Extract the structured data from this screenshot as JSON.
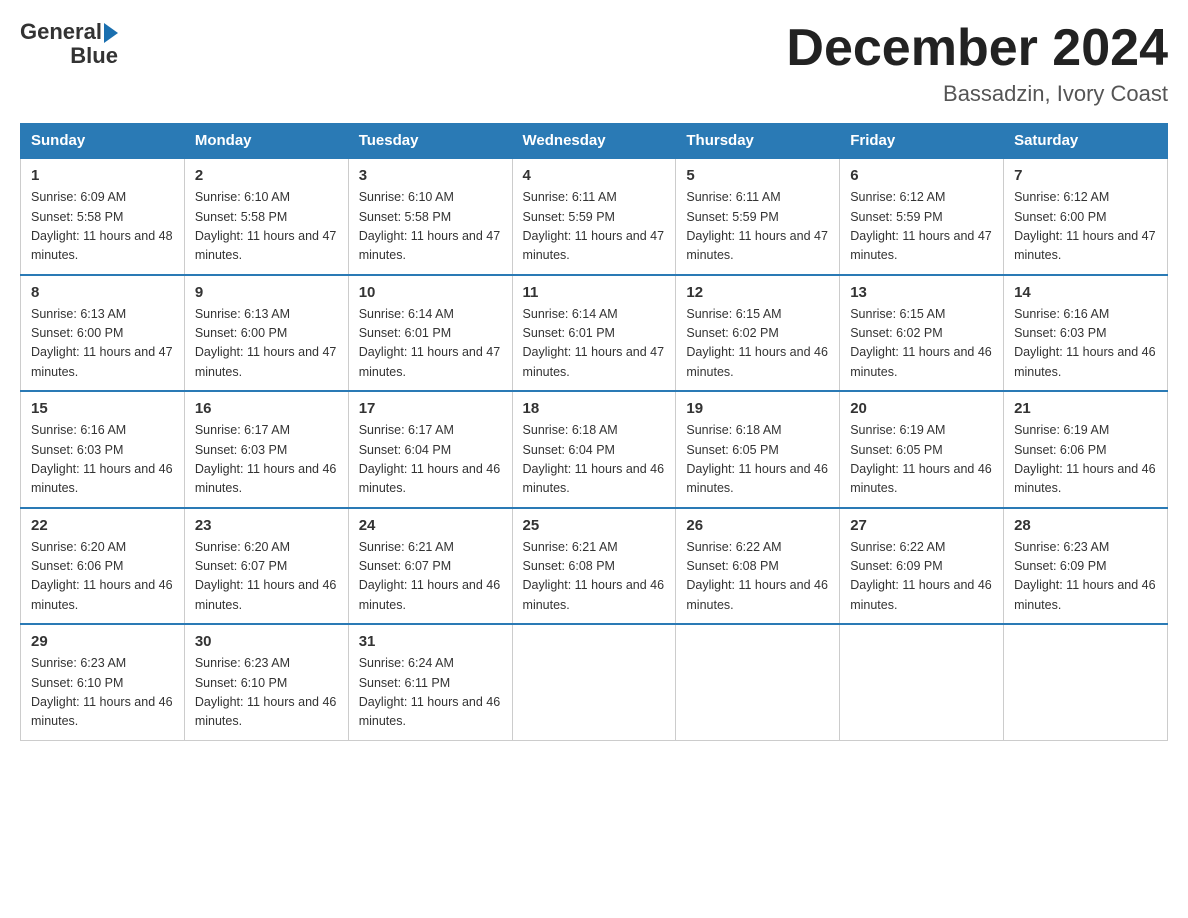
{
  "header": {
    "logo_text_general": "General",
    "logo_text_blue": "Blue",
    "month_title": "December 2024",
    "location": "Bassadzin, Ivory Coast"
  },
  "days_of_week": [
    "Sunday",
    "Monday",
    "Tuesday",
    "Wednesday",
    "Thursday",
    "Friday",
    "Saturday"
  ],
  "weeks": [
    [
      {
        "day": "1",
        "sunrise": "6:09 AM",
        "sunset": "5:58 PM",
        "daylight": "11 hours and 48 minutes."
      },
      {
        "day": "2",
        "sunrise": "6:10 AM",
        "sunset": "5:58 PM",
        "daylight": "11 hours and 47 minutes."
      },
      {
        "day": "3",
        "sunrise": "6:10 AM",
        "sunset": "5:58 PM",
        "daylight": "11 hours and 47 minutes."
      },
      {
        "day": "4",
        "sunrise": "6:11 AM",
        "sunset": "5:59 PM",
        "daylight": "11 hours and 47 minutes."
      },
      {
        "day": "5",
        "sunrise": "6:11 AM",
        "sunset": "5:59 PM",
        "daylight": "11 hours and 47 minutes."
      },
      {
        "day": "6",
        "sunrise": "6:12 AM",
        "sunset": "5:59 PM",
        "daylight": "11 hours and 47 minutes."
      },
      {
        "day": "7",
        "sunrise": "6:12 AM",
        "sunset": "6:00 PM",
        "daylight": "11 hours and 47 minutes."
      }
    ],
    [
      {
        "day": "8",
        "sunrise": "6:13 AM",
        "sunset": "6:00 PM",
        "daylight": "11 hours and 47 minutes."
      },
      {
        "day": "9",
        "sunrise": "6:13 AM",
        "sunset": "6:00 PM",
        "daylight": "11 hours and 47 minutes."
      },
      {
        "day": "10",
        "sunrise": "6:14 AM",
        "sunset": "6:01 PM",
        "daylight": "11 hours and 47 minutes."
      },
      {
        "day": "11",
        "sunrise": "6:14 AM",
        "sunset": "6:01 PM",
        "daylight": "11 hours and 47 minutes."
      },
      {
        "day": "12",
        "sunrise": "6:15 AM",
        "sunset": "6:02 PM",
        "daylight": "11 hours and 46 minutes."
      },
      {
        "day": "13",
        "sunrise": "6:15 AM",
        "sunset": "6:02 PM",
        "daylight": "11 hours and 46 minutes."
      },
      {
        "day": "14",
        "sunrise": "6:16 AM",
        "sunset": "6:03 PM",
        "daylight": "11 hours and 46 minutes."
      }
    ],
    [
      {
        "day": "15",
        "sunrise": "6:16 AM",
        "sunset": "6:03 PM",
        "daylight": "11 hours and 46 minutes."
      },
      {
        "day": "16",
        "sunrise": "6:17 AM",
        "sunset": "6:03 PM",
        "daylight": "11 hours and 46 minutes."
      },
      {
        "day": "17",
        "sunrise": "6:17 AM",
        "sunset": "6:04 PM",
        "daylight": "11 hours and 46 minutes."
      },
      {
        "day": "18",
        "sunrise": "6:18 AM",
        "sunset": "6:04 PM",
        "daylight": "11 hours and 46 minutes."
      },
      {
        "day": "19",
        "sunrise": "6:18 AM",
        "sunset": "6:05 PM",
        "daylight": "11 hours and 46 minutes."
      },
      {
        "day": "20",
        "sunrise": "6:19 AM",
        "sunset": "6:05 PM",
        "daylight": "11 hours and 46 minutes."
      },
      {
        "day": "21",
        "sunrise": "6:19 AM",
        "sunset": "6:06 PM",
        "daylight": "11 hours and 46 minutes."
      }
    ],
    [
      {
        "day": "22",
        "sunrise": "6:20 AM",
        "sunset": "6:06 PM",
        "daylight": "11 hours and 46 minutes."
      },
      {
        "day": "23",
        "sunrise": "6:20 AM",
        "sunset": "6:07 PM",
        "daylight": "11 hours and 46 minutes."
      },
      {
        "day": "24",
        "sunrise": "6:21 AM",
        "sunset": "6:07 PM",
        "daylight": "11 hours and 46 minutes."
      },
      {
        "day": "25",
        "sunrise": "6:21 AM",
        "sunset": "6:08 PM",
        "daylight": "11 hours and 46 minutes."
      },
      {
        "day": "26",
        "sunrise": "6:22 AM",
        "sunset": "6:08 PM",
        "daylight": "11 hours and 46 minutes."
      },
      {
        "day": "27",
        "sunrise": "6:22 AM",
        "sunset": "6:09 PM",
        "daylight": "11 hours and 46 minutes."
      },
      {
        "day": "28",
        "sunrise": "6:23 AM",
        "sunset": "6:09 PM",
        "daylight": "11 hours and 46 minutes."
      }
    ],
    [
      {
        "day": "29",
        "sunrise": "6:23 AM",
        "sunset": "6:10 PM",
        "daylight": "11 hours and 46 minutes."
      },
      {
        "day": "30",
        "sunrise": "6:23 AM",
        "sunset": "6:10 PM",
        "daylight": "11 hours and 46 minutes."
      },
      {
        "day": "31",
        "sunrise": "6:24 AM",
        "sunset": "6:11 PM",
        "daylight": "11 hours and 46 minutes."
      },
      null,
      null,
      null,
      null
    ]
  ]
}
